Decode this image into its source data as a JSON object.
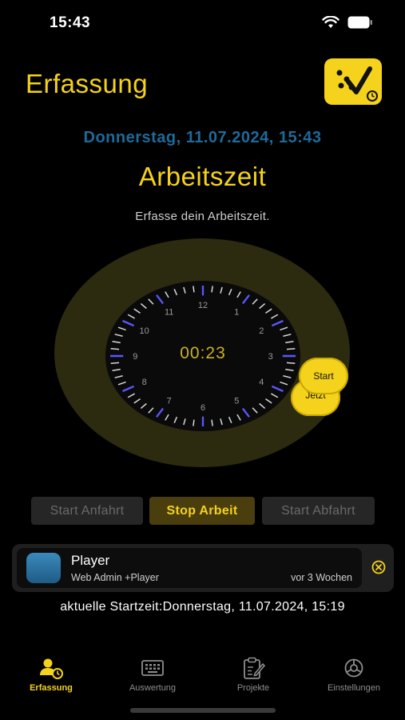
{
  "status_bar": {
    "time": "15:43"
  },
  "header": {
    "title": "Erfassung"
  },
  "datetime": "Donnerstag, 11.07.2024, 15:43",
  "section": {
    "title": "Arbeitszeit",
    "subtitle": "Erfasse dein Arbeitszeit."
  },
  "clock": {
    "elapsed": "00:23",
    "numbers": [
      "12",
      "1",
      "2",
      "3",
      "4",
      "5",
      "6",
      "7",
      "8",
      "9",
      "10",
      "11"
    ]
  },
  "clock_buttons": {
    "start": "Start",
    "jetzt": "Jetzt"
  },
  "actions": {
    "start_anfahrt": "Start Anfahrt",
    "stop_arbeit": "Stop Arbeit",
    "start_abfahrt": "Start Abfahrt"
  },
  "player_card": {
    "name": "Player",
    "subtitle": "Web Admin +Player",
    "time": "vor 3 Wochen"
  },
  "start_info": "aktuelle Startzeit:Donnerstag, 11.07.2024, 15:19",
  "tabs": [
    {
      "label": "Erfassung",
      "icon": "person-clock-icon",
      "active": true
    },
    {
      "label": "Auswertung",
      "icon": "keyboard-icon",
      "active": false
    },
    {
      "label": "Projekte",
      "icon": "clipboard-pen-icon",
      "active": false
    },
    {
      "label": "Einstellungen",
      "icon": "gear-icon",
      "active": false
    }
  ],
  "colors": {
    "accent": "#f5d21c",
    "date_blue": "#1f6a9a",
    "ring": "#2c2a0f",
    "tick_blue": "#5b55ff"
  }
}
